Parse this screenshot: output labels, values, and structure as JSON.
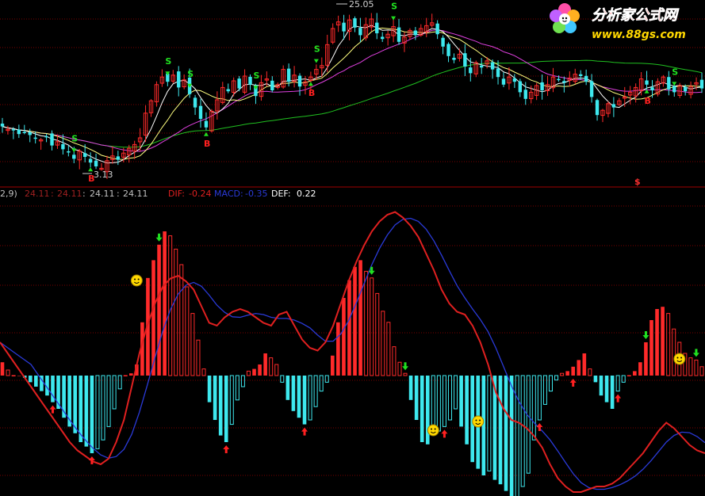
{
  "colors": {
    "bg": "#000000",
    "grid": "#7a0000",
    "up": "#ff2a2a",
    "down": "#3ee8ee",
    "dif": "#e02020",
    "macd": "#2a3ad8",
    "def": "#ffffff",
    "ma5": "#ffffff",
    "ma10": "#ffff80",
    "ma20": "#e040e0",
    "ma60": "#20c020",
    "buy": "#ff2020",
    "sell": "#20e020"
  },
  "logo": {
    "title": "分析家公式网",
    "url": "www.88gs.com",
    "title_color": "#ff2020",
    "url_color": "#ffd800"
  },
  "price_panel": {
    "high_label": "25.05",
    "low_label": "3.13",
    "signal_buy": "B",
    "signal_sell": "S",
    "dollar": "$"
  },
  "indicator_header": {
    "param": "2,9)",
    "v1": "24.11",
    "sep1": ":",
    "v2": "24.11",
    "sep2": ":",
    "v3": "24.11",
    "sep3": ":",
    "v4": "24.11",
    "dif_label": "DIF:",
    "dif_value": "-0.24",
    "macd_label": "MACD:",
    "macd_value": "-0.35",
    "def_label": "DEF:",
    "def_value": "0.22"
  },
  "chart_data": [
    {
      "type": "candlestick",
      "bars": 128,
      "close": [
        13.2,
        12.9,
        12.8,
        12.4,
        12.6,
        12.3,
        12.0,
        11.8,
        12.1,
        11.2,
        11.6,
        10.8,
        10.5,
        9.8,
        10.6,
        10.0,
        9.4,
        9.0,
        8.8,
        9.6,
        10.1,
        9.7,
        10.4,
        10.9,
        11.3,
        12.0,
        14.6,
        15.9,
        17.6,
        18.4,
        17.9,
        18.6,
        17.3,
        18.1,
        16.6,
        15.2,
        14.0,
        13.1,
        14.8,
        16.0,
        17.3,
        16.9,
        18.0,
        17.2,
        18.5,
        17.6,
        16.4,
        17.8,
        18.2,
        17.0,
        17.6,
        19.2,
        17.9,
        18.6,
        17.4,
        17.9,
        18.4,
        19.2,
        19.6,
        21.8,
        23.5,
        24.2,
        23.2,
        24.4,
        23.6,
        22.8,
        23.9,
        24.5,
        23.0,
        22.4,
        22.9,
        23.7,
        22.1,
        22.6,
        23.3,
        22.8,
        23.5,
        23.8,
        24.1,
        22.9,
        21.6,
        20.6,
        20.2,
        20.8,
        19.5,
        18.8,
        19.9,
        19.4,
        20.1,
        19.2,
        18.4,
        17.6,
        18.4,
        17.9,
        16.8,
        16.1,
        16.8,
        17.5,
        17.0,
        17.6,
        18.4,
        18.1,
        17.8,
        18.3,
        18.7,
        18.5,
        17.9,
        16.3,
        14.4,
        14.9,
        15.6,
        15.2,
        15.9,
        16.3,
        16.8,
        17.3,
        18.2,
        17.6,
        17.0,
        17.9,
        18.4,
        17.1,
        16.8,
        17.5,
        16.9,
        17.4,
        17.8,
        17.2
      ],
      "price_range": [
        3.13,
        25.05
      ],
      "marked_high": 25.05,
      "marked_low": 3.13,
      "moving_averages": [
        "MA5",
        "MA10",
        "MA20",
        "MA60"
      ]
    },
    {
      "type": "bar",
      "name": "MACD",
      "dif_last": -0.24,
      "macd_last": -0.35,
      "def_last": 0.22,
      "histogram": [
        0.12,
        0.05,
        0.0,
        0.0,
        -0.02,
        -0.06,
        -0.1,
        -0.14,
        -0.18,
        -0.24,
        -0.3,
        -0.38,
        -0.46,
        -0.52,
        -0.6,
        -0.64,
        -0.7,
        -0.66,
        -0.58,
        -0.46,
        -0.3,
        -0.12,
        0.0,
        0.02,
        0.1,
        0.48,
        0.88,
        1.04,
        1.18,
        1.3,
        1.26,
        1.14,
        1.0,
        0.8,
        0.56,
        0.32,
        0.06,
        -0.24,
        -0.4,
        -0.54,
        -0.6,
        -0.44,
        -0.22,
        -0.1,
        0.04,
        0.06,
        0.1,
        0.2,
        0.16,
        0.1,
        -0.06,
        -0.22,
        -0.32,
        -0.38,
        -0.44,
        -0.4,
        -0.28,
        -0.14,
        -0.06,
        0.18,
        0.48,
        0.7,
        0.86,
        0.98,
        1.04,
        0.94,
        0.88,
        0.74,
        0.58,
        0.48,
        0.26,
        0.12,
        0.02,
        -0.22,
        -0.4,
        -0.6,
        -0.62,
        -0.54,
        -0.5,
        -0.46,
        -0.4,
        -0.3,
        -0.46,
        -0.62,
        -0.78,
        -0.84,
        -0.9,
        -0.86,
        -0.94,
        -0.98,
        -1.04,
        -1.12,
        -1.1,
        -1.0,
        -0.88,
        -0.58,
        -0.4,
        -0.26,
        -0.14,
        -0.04,
        0.02,
        0.04,
        0.08,
        0.14,
        0.2,
        0.06,
        -0.06,
        -0.18,
        -0.24,
        -0.3,
        -0.14,
        -0.06,
        0.0,
        0.04,
        0.12,
        0.3,
        0.5,
        0.6,
        0.62,
        0.56,
        0.42,
        0.3,
        0.2,
        0.16,
        0.14,
        0.08
      ],
      "dif": [
        0.6,
        0.4,
        0.2,
        0.0,
        -0.2,
        -0.4,
        -0.6,
        -0.8,
        -1.0,
        -1.2,
        -1.35,
        -1.45,
        -1.55,
        -1.6,
        -1.5,
        -1.2,
        -0.8,
        -0.2,
        0.4,
        0.9,
        1.3,
        1.6,
        1.75,
        1.8,
        1.7,
        1.55,
        1.25,
        0.95,
        0.9,
        1.05,
        1.15,
        1.2,
        1.15,
        1.05,
        0.95,
        0.9,
        1.1,
        1.15,
        0.9,
        0.65,
        0.5,
        0.45,
        0.6,
        0.9,
        1.3,
        1.7,
        2.05,
        2.35,
        2.6,
        2.78,
        2.9,
        2.95,
        2.85,
        2.7,
        2.5,
        2.2,
        1.9,
        1.55,
        1.3,
        1.15,
        1.1,
        0.9,
        0.6,
        0.2,
        -0.3,
        -0.6,
        -0.8,
        -0.85,
        -0.95,
        -1.1,
        -1.3,
        -1.6,
        -1.85,
        -2.0,
        -2.1,
        -2.1,
        -2.05,
        -2.0,
        -2.0,
        -1.95,
        -1.85,
        -1.7,
        -1.55,
        -1.4,
        -1.2,
        -1.0,
        -0.85,
        -0.95,
        -1.1,
        -1.25,
        -1.35,
        -1.4
      ]
    }
  ]
}
